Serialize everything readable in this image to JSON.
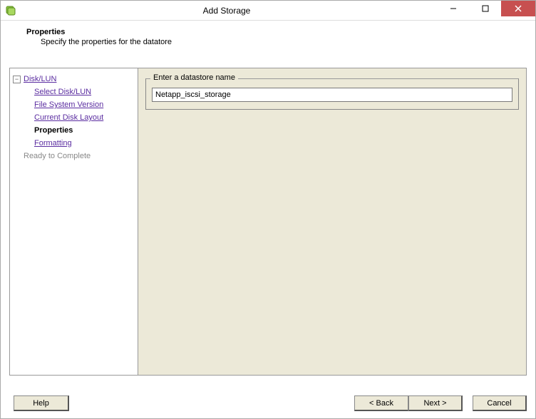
{
  "window": {
    "title": "Add Storage"
  },
  "header": {
    "title": "Properties",
    "description": "Specify the properties for the datatore"
  },
  "sidebar": {
    "root": {
      "label": "Disk/LUN",
      "items": [
        {
          "label": "Select Disk/LUN"
        },
        {
          "label": "File System Version"
        },
        {
          "label": "Current Disk Layout"
        },
        {
          "label": "Properties"
        },
        {
          "label": "Formatting"
        }
      ]
    },
    "ready": "Ready to Complete"
  },
  "content": {
    "legend": "Enter a datastore name",
    "datastore_value": "Netapp_iscsi_storage"
  },
  "footer": {
    "help": "Help",
    "back": "< Back",
    "next": "Next >",
    "cancel": "Cancel"
  }
}
